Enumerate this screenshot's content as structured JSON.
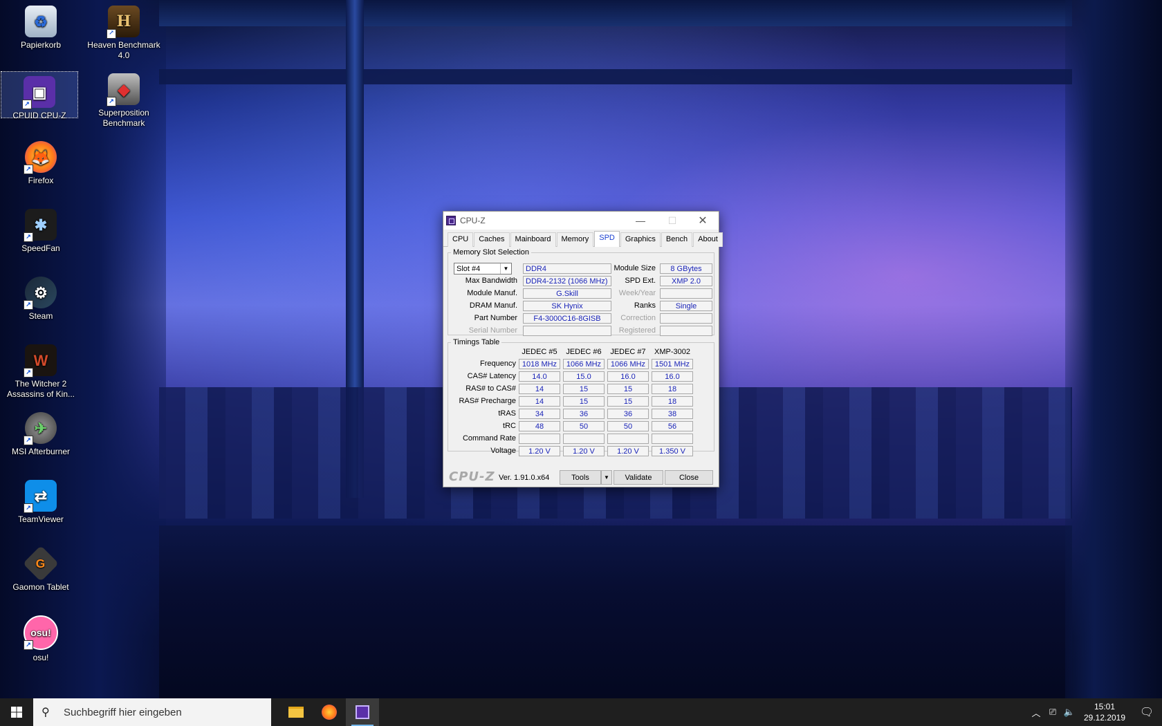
{
  "desktop_icons": [
    {
      "label": "Papierkorb",
      "icon": "recycle-bin-icon"
    },
    {
      "label": "Heaven Benchmark 4.0",
      "icon": "heaven-benchmark-icon"
    },
    {
      "label": "CPUID CPU-Z",
      "icon": "cpuz-icon"
    },
    {
      "label": "Superposition Benchmark",
      "icon": "superposition-icon"
    },
    {
      "label": "Firefox",
      "icon": "firefox-icon"
    },
    {
      "label": "SpeedFan",
      "icon": "speedfan-icon"
    },
    {
      "label": "Steam",
      "icon": "steam-icon"
    },
    {
      "label": "The Witcher 2 Assassins of Kin...",
      "icon": "witcher-icon"
    },
    {
      "label": "MSI Afterburner",
      "icon": "msi-afterburner-icon"
    },
    {
      "label": "TeamViewer",
      "icon": "teamviewer-icon"
    },
    {
      "label": "Gaomon Tablet",
      "icon": "gaomon-icon"
    },
    {
      "label": "osu!",
      "icon": "osu-icon",
      "glyph": "osu!"
    }
  ],
  "cpuz": {
    "title": "CPU-Z",
    "tabs": [
      "CPU",
      "Caches",
      "Mainboard",
      "Memory",
      "SPD",
      "Graphics",
      "Bench",
      "About"
    ],
    "active_tab": "SPD",
    "slot_group": {
      "legend": "Memory Slot Selection",
      "slot_selected": "Slot #4",
      "type": "DDR4",
      "module_size_label": "Module Size",
      "module_size": "8 GBytes",
      "max_bandwidth_label": "Max Bandwidth",
      "max_bandwidth": "DDR4-2132 (1066 MHz)",
      "spd_ext_label": "SPD Ext.",
      "spd_ext": "XMP 2.0",
      "module_manuf_label": "Module Manuf.",
      "module_manuf": "G.Skill",
      "week_year_label": "Week/Year",
      "week_year": "",
      "dram_manuf_label": "DRAM Manuf.",
      "dram_manuf": "SK Hynix",
      "ranks_label": "Ranks",
      "ranks": "Single",
      "part_number_label": "Part Number",
      "part_number": "F4-3000C16-8GISB",
      "correction_label": "Correction",
      "correction": "",
      "serial_number_label": "Serial Number",
      "serial_number": "",
      "registered_label": "Registered",
      "registered": ""
    },
    "timings": {
      "legend": "Timings Table",
      "columns": [
        "JEDEC #5",
        "JEDEC #6",
        "JEDEC #7",
        "XMP-3002"
      ],
      "rows": [
        {
          "label": "Frequency",
          "values": [
            "1018 MHz",
            "1066 MHz",
            "1066 MHz",
            "1501 MHz"
          ]
        },
        {
          "label": "CAS# Latency",
          "values": [
            "14.0",
            "15.0",
            "16.0",
            "16.0"
          ]
        },
        {
          "label": "RAS# to CAS#",
          "values": [
            "14",
            "15",
            "15",
            "18"
          ]
        },
        {
          "label": "RAS# Precharge",
          "values": [
            "14",
            "15",
            "15",
            "18"
          ]
        },
        {
          "label": "tRAS",
          "values": [
            "34",
            "36",
            "36",
            "38"
          ]
        },
        {
          "label": "tRC",
          "values": [
            "48",
            "50",
            "50",
            "56"
          ]
        },
        {
          "label": "Command Rate",
          "values": [
            "",
            "",
            "",
            ""
          ]
        },
        {
          "label": "Voltage",
          "values": [
            "1.20 V",
            "1.20 V",
            "1.20 V",
            "1.350 V"
          ]
        }
      ]
    },
    "footer": {
      "brand": "CPU-Z",
      "version": "Ver. 1.91.0.x64",
      "tools_label": "Tools",
      "validate_label": "Validate",
      "close_label": "Close"
    }
  },
  "taskbar": {
    "search_placeholder": "Suchbegriff hier eingeben",
    "apps": [
      "file-explorer-icon",
      "firefox-icon",
      "cpuz-icon"
    ],
    "active_app": "cpuz-icon",
    "time": "15:01",
    "date": "29.12.2019"
  }
}
